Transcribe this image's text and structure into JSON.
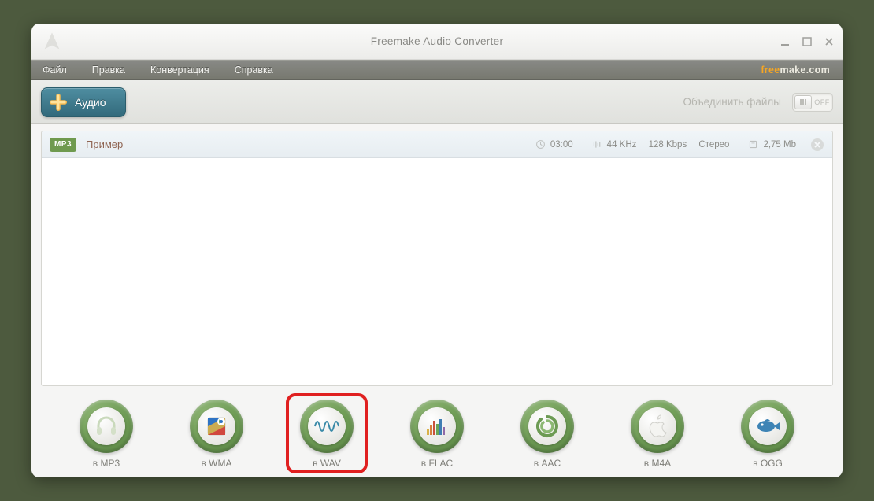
{
  "window": {
    "title": "Freemake Audio Converter"
  },
  "brand": {
    "part1": "free",
    "part2": "make.com"
  },
  "menu": {
    "file": "Файл",
    "edit": "Правка",
    "convert": "Конвертация",
    "help": "Справка"
  },
  "toolbar": {
    "audio_label": "Аудио",
    "merge_label": "Объединить файлы",
    "toggle_state": "OFF"
  },
  "files": [
    {
      "badge": "MP3",
      "name": "Пример",
      "duration": "03:00",
      "freq": "44 KHz",
      "bitrate": "128 Kbps",
      "channels": "Стерео",
      "size": "2,75 Mb"
    }
  ],
  "formats": [
    {
      "key": "mp3",
      "label": "в MP3",
      "icon": "headphones"
    },
    {
      "key": "wma",
      "label": "в WMA",
      "icon": "wma-flag"
    },
    {
      "key": "wav",
      "label": "в WAV",
      "icon": "waveform",
      "highlight": true
    },
    {
      "key": "flac",
      "label": "в FLAC",
      "icon": "bars"
    },
    {
      "key": "aac",
      "label": "в AAC",
      "icon": "swirl"
    },
    {
      "key": "m4a",
      "label": "в M4A",
      "icon": "apple"
    },
    {
      "key": "ogg",
      "label": "в OGG",
      "icon": "fish"
    }
  ]
}
